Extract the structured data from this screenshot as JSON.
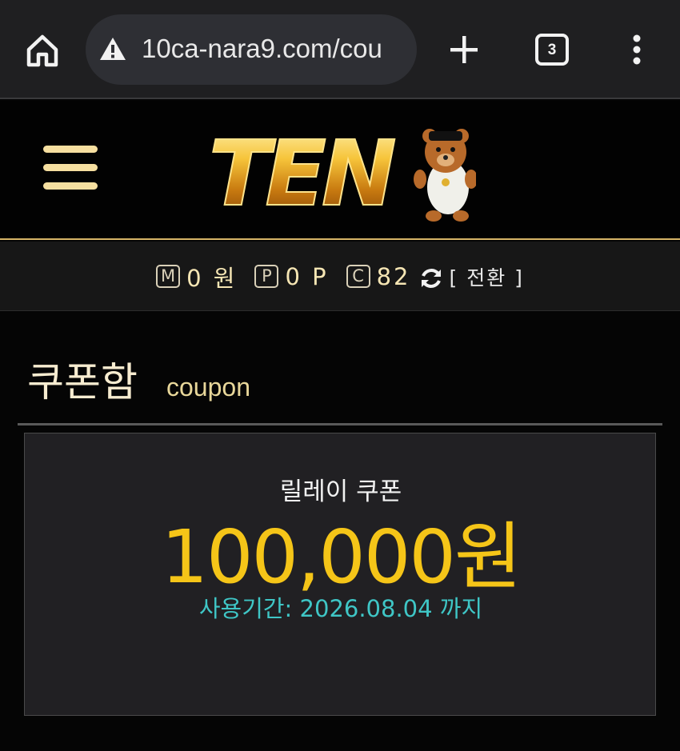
{
  "browser": {
    "url": "10ca-nara9.com/cou",
    "tab_count": "3",
    "icons": [
      "home-icon",
      "warning-icon",
      "plus-icon",
      "tabs-icon",
      "more-vert-icon"
    ]
  },
  "header": {
    "logo_text": "TEN",
    "icons": [
      "hamburger-menu-icon",
      "bear-mascot"
    ]
  },
  "balance": {
    "money": {
      "badge": "M",
      "value": "0 원"
    },
    "point": {
      "badge": "P",
      "value": "0 P"
    },
    "coin": {
      "badge": "C",
      "value": "82"
    },
    "switch_label": "[ 전환 ]"
  },
  "coupon_section": {
    "title": "쿠폰함",
    "subtitle": "coupon"
  },
  "coupons": [
    {
      "name": "릴레이 쿠폰",
      "amount": "100,000원",
      "period": "사용기간: 2026.08.04 까지"
    }
  ],
  "colors": {
    "accent_gold": "#f5c518",
    "period_cyan": "#3fc6c6",
    "header_border": "#d6b567"
  }
}
